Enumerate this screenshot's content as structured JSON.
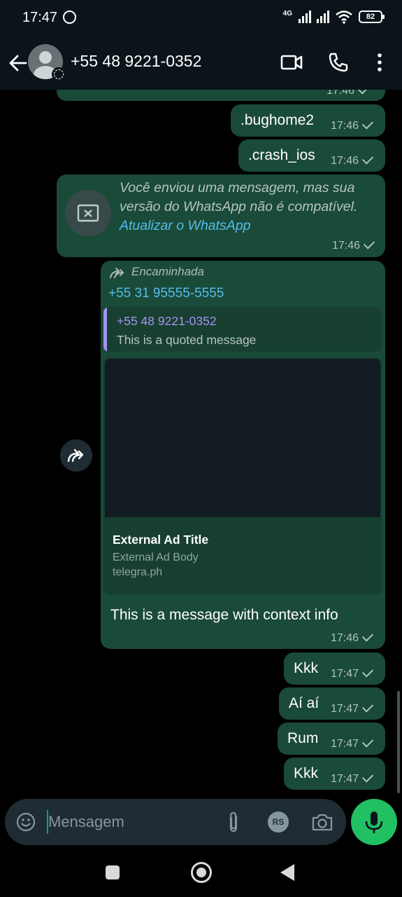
{
  "status_bar": {
    "time": "17:47",
    "network": "4G",
    "battery": "82"
  },
  "header": {
    "contact_name": "+55 48 9221-0352"
  },
  "messages": {
    "partial_top": {
      "time": "17:46"
    },
    "m1": {
      "text": ".bughome2",
      "time": "17:46"
    },
    "m2": {
      "text": ".crash_ios",
      "time": "17:46"
    },
    "unsupported": {
      "text": "Você enviou uma mensagem, mas sua versão do WhatsApp não é compatível.",
      "link": "Atualizar o WhatsApp",
      "time": "17:46"
    },
    "forwarded": {
      "forward_label": "Encaminhada",
      "sender": "+55 31 95555-5555",
      "quoted_name": "+55 48 9221-0352",
      "quoted_text": "This is a quoted message",
      "ad_title": "External Ad Title",
      "ad_body": "External Ad Body",
      "ad_url": "telegra.ph",
      "text": "This is a message with context info",
      "time": "17:46"
    },
    "m3": {
      "text": "Kkk",
      "time": "17:47"
    },
    "m4": {
      "text": "Aí aí",
      "time": "17:47"
    },
    "m5": {
      "text": "Rum",
      "time": "17:47"
    },
    "m6": {
      "text": "Kkk",
      "time": "17:47"
    }
  },
  "input": {
    "placeholder": "Mensagem",
    "rs_badge": "RS"
  },
  "colors": {
    "bubble": "#1a4a38",
    "accent": "#21c063",
    "link": "#53bdeb",
    "quote_accent": "#a791f7"
  }
}
